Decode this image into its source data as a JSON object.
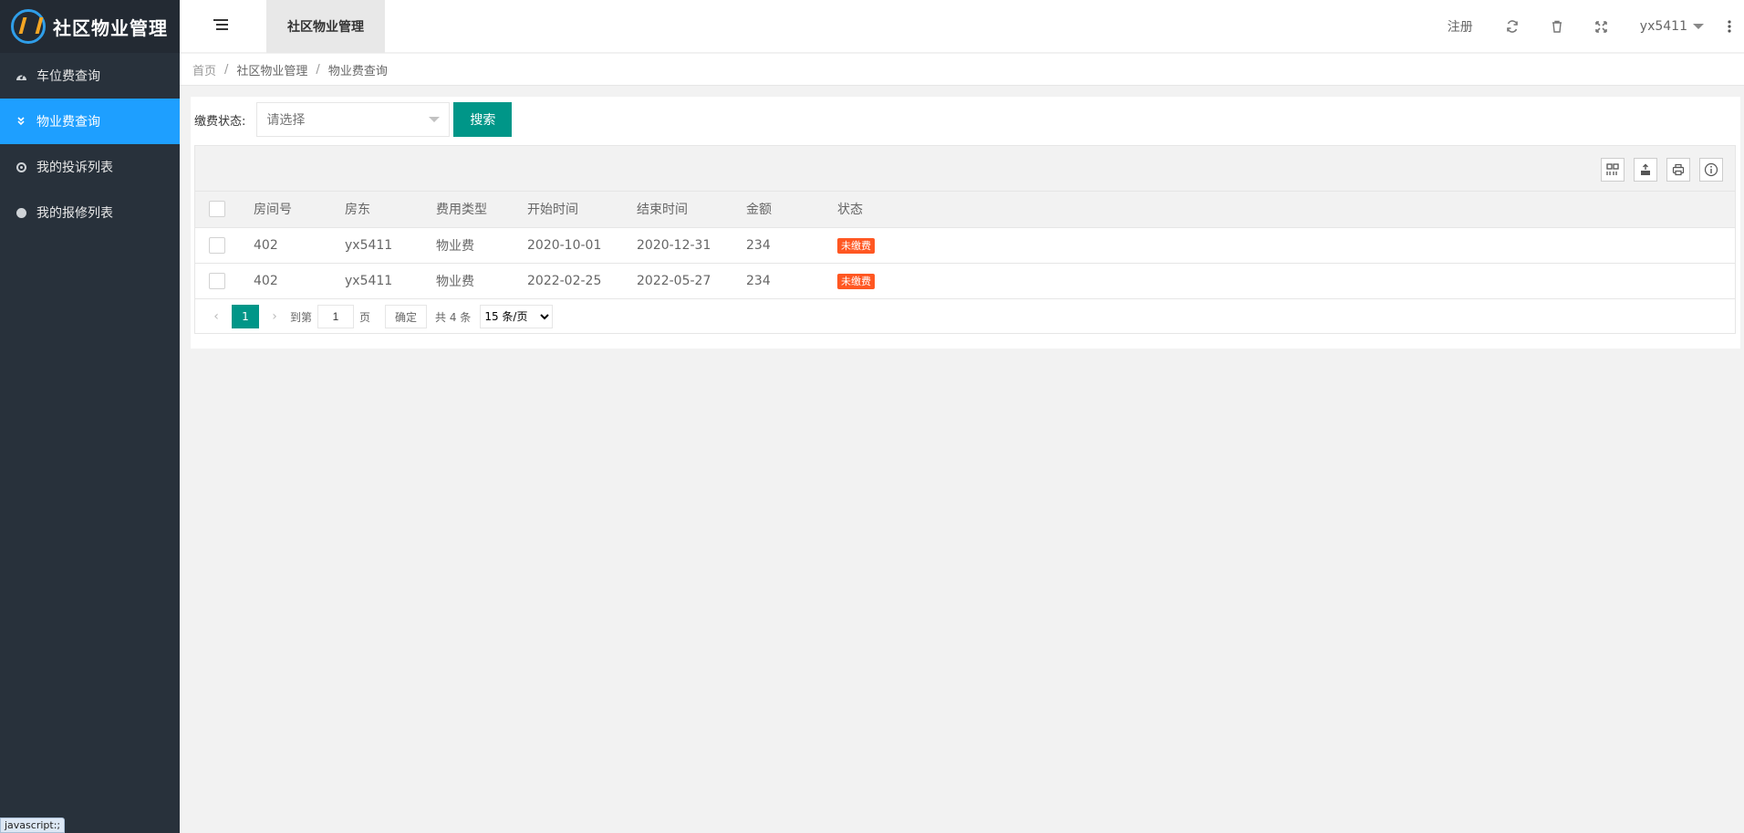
{
  "app": {
    "title": "社区物业管理"
  },
  "sidebar": {
    "items": [
      {
        "label": "车位费查询",
        "icon": "dashboard-icon",
        "active": false
      },
      {
        "label": "物业费查询",
        "icon": "double-chevron-down-icon",
        "active": true
      },
      {
        "label": "我的投诉列表",
        "icon": "target-icon",
        "active": false
      },
      {
        "label": "我的报修列表",
        "icon": "circle-icon",
        "active": false
      }
    ]
  },
  "header": {
    "tab_label": "社区物业管理",
    "register_label": "注册",
    "username": "yx5411"
  },
  "breadcrumb": [
    "首页",
    "社区物业管理",
    "物业费查询"
  ],
  "search": {
    "label": "缴费状态:",
    "select_placeholder": "请选择",
    "button_label": "搜索"
  },
  "table": {
    "columns": [
      "房间号",
      "房东",
      "费用类型",
      "开始时间",
      "结束时间",
      "金额",
      "状态"
    ],
    "rows": [
      {
        "room": "402",
        "owner": "yx5411",
        "fee_type": "物业费",
        "start": "2020-10-01",
        "end": "2020-12-31",
        "amount": "234",
        "status": "未缴费"
      },
      {
        "room": "402",
        "owner": "yx5411",
        "fee_type": "物业费",
        "start": "2022-02-25",
        "end": "2022-05-27",
        "amount": "234",
        "status": "未缴费"
      }
    ]
  },
  "pagination": {
    "current": "1",
    "goto_label": "到第",
    "page_input": "1",
    "page_unit": "页",
    "confirm_label": "确定",
    "total": "共 4 条",
    "limit": "15 条/页"
  },
  "status_tip": "javascript:;",
  "colors": {
    "sidebar_bg": "#28313b",
    "active_blue": "#1e9fff",
    "primary_green": "#009688",
    "badge_orange": "#ff5722"
  }
}
